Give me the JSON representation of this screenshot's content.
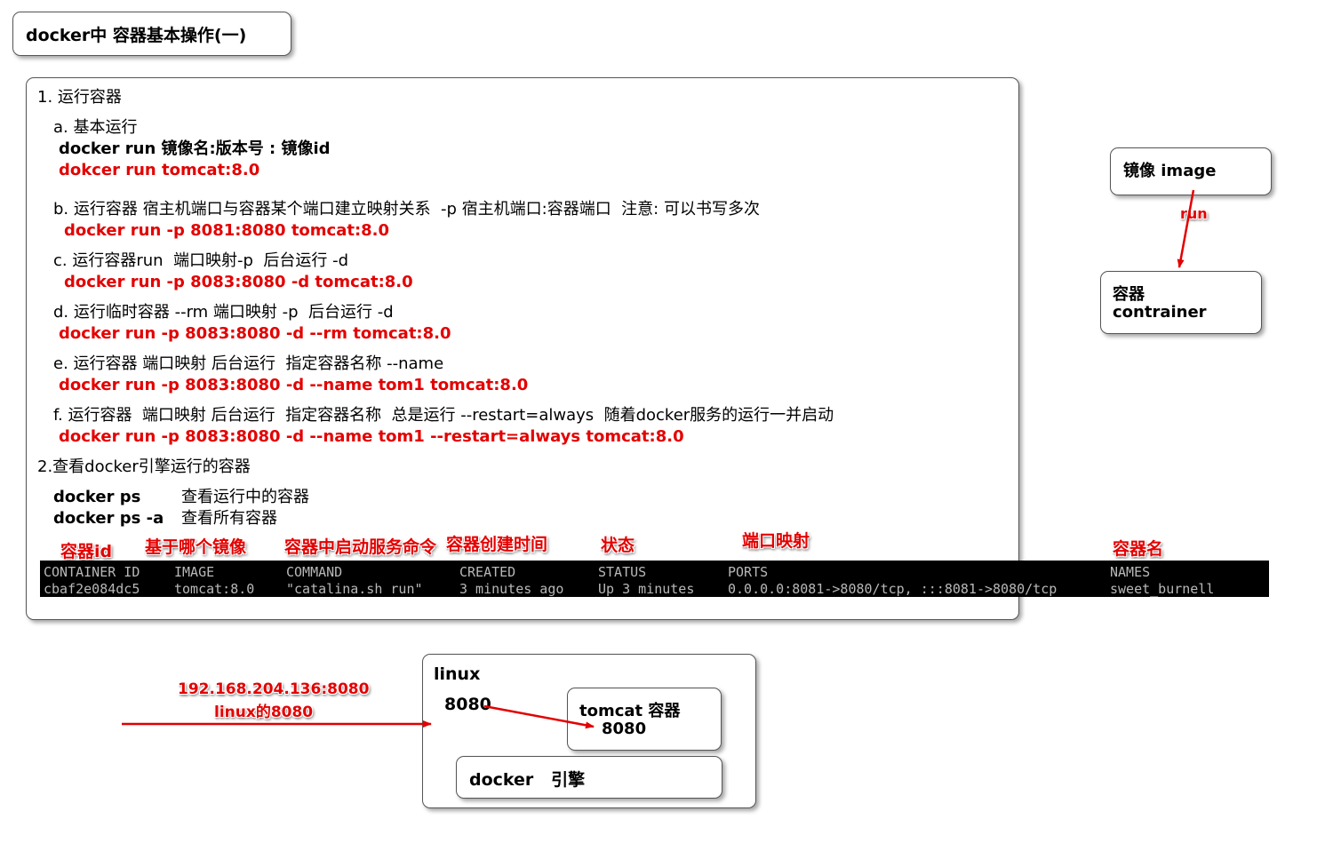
{
  "title": "docker中 容器基本操作(一)",
  "main": {
    "s1_heading": "1. 运行容器",
    "a_heading": "a. 基本运行",
    "a_syntax": "docker run 镜像名:版本号 : 镜像id",
    "a_example": "dokcer run tomcat:8.0",
    "b_heading": "b. 运行容器 宿主机端口与容器某个端口建立映射关系  -p 宿主机端口:容器端口  注意: 可以书写多次",
    "b_example": "docker run -p 8081:8080 tomcat:8.0",
    "c_heading": "c. 运行容器run  端口映射-p  后台运行 -d",
    "c_example": "docker run -p 8083:8080 -d tomcat:8.0",
    "d_heading": "d. 运行临时容器 --rm 端口映射 -p  后台运行 -d",
    "d_example": "docker run -p 8083:8080 -d --rm tomcat:8.0",
    "e_heading": "e. 运行容器 端口映射 后台运行  指定容器名称 --name",
    "e_example": "docker run -p 8083:8080 -d --name tom1 tomcat:8.0",
    "f_heading": "f. 运行容器  端口映射 后台运行  指定容器名称  总是运行 --restart=always  随着docker服务的运行一并启动",
    "f_example": "docker run -p 8083:8080 -d --name tom1 --restart=always tomcat:8.0",
    "s2_heading": "2.查看docker引擎运行的容器",
    "ps_cmd": "docker ps",
    "ps_desc": "查看运行中的容器",
    "psa_cmd": "docker ps -a",
    "psa_desc": "查看所有容器"
  },
  "annotations": {
    "container_id": "容器id",
    "image": "基于哪个镜像",
    "command": "容器中启动服务命令",
    "created": "容器创建时间",
    "status": "状态",
    "ports": "端口映射",
    "names": "容器名"
  },
  "terminal": {
    "headers": [
      "CONTAINER ID",
      "IMAGE",
      "COMMAND",
      "CREATED",
      "STATUS",
      "PORTS",
      "NAMES"
    ],
    "row": [
      "cbaf2e084dc5",
      "tomcat:8.0",
      "\"catalina.sh run\"",
      "3 minutes ago",
      "Up 3 minutes",
      "0.0.0.0:8081->8080/tcp, :::8081->8080/tcp",
      "sweet_burnell"
    ]
  },
  "side": {
    "image_label": "镜像 image",
    "run_label": "run",
    "container_line1": "容器",
    "container_line2": "contrainer"
  },
  "bottom": {
    "ip_line1": "192.168.204.136:8080",
    "ip_line2": "linux的8080",
    "linux_label": "linux",
    "linux_port": "8080",
    "tomcat_label": "tomcat 容器",
    "tomcat_port": "8080",
    "docker_label": "docker   引擎"
  },
  "colors": {
    "accent_red": "#e30000",
    "terminal_bg": "#000000",
    "terminal_fg": "#b8b8b8"
  }
}
